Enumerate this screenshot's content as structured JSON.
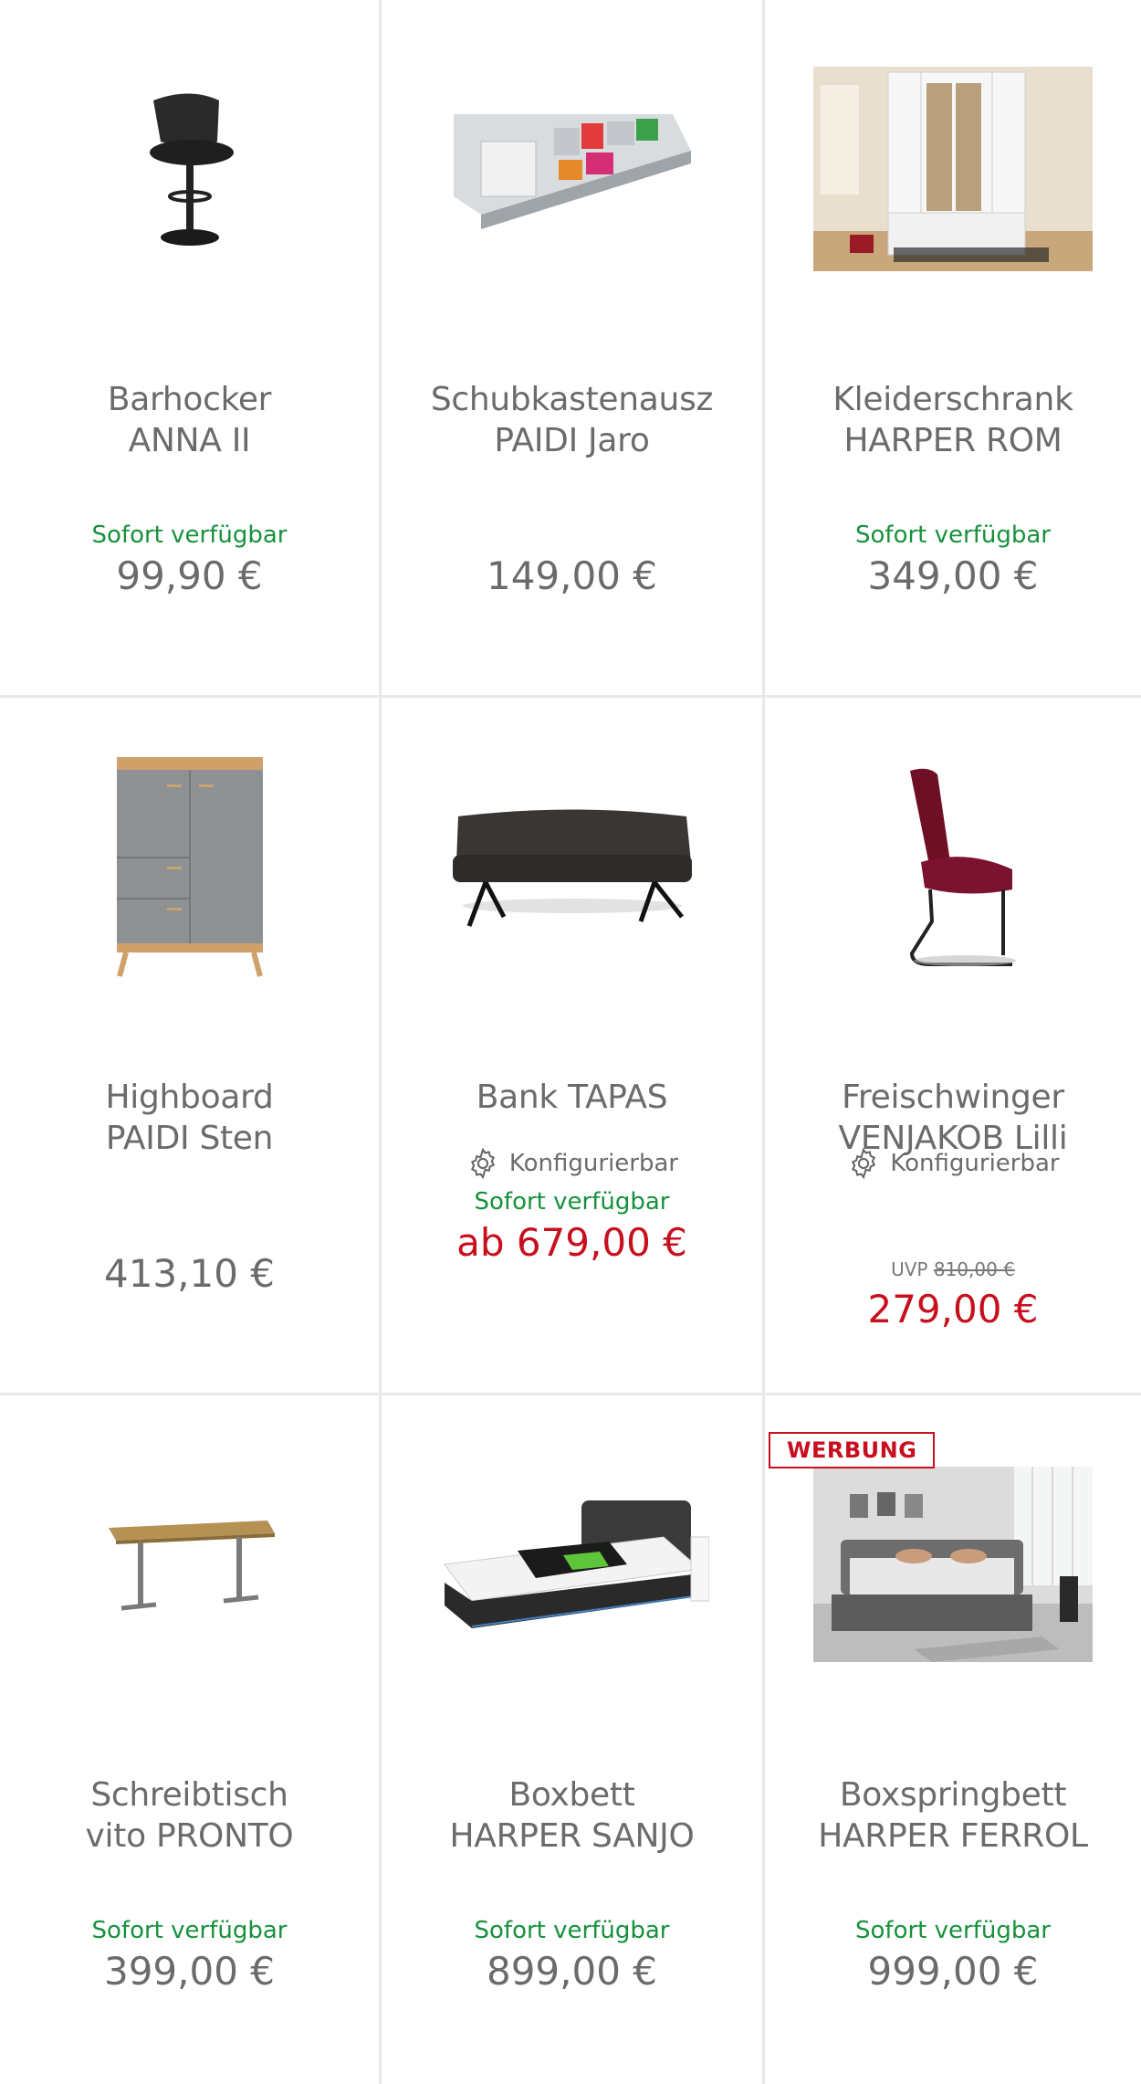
{
  "products": [
    {
      "title_line1": "Barhocker",
      "title_line2": "ANNA II",
      "availability": "Sofort verfügbar",
      "price": "99,90 €",
      "image": "bar-stool-image"
    },
    {
      "title_line1": "Schubkastenausz",
      "title_line2": "PAIDI Jaro",
      "availability": "",
      "price": "149,00 €",
      "image": "drawer-organizer-image"
    },
    {
      "title_line1": "Kleiderschrank",
      "title_line2": "HARPER ROM",
      "availability": "Sofort verfügbar",
      "price": "349,00 €",
      "image": "wardrobe-image"
    },
    {
      "title_line1": "Highboard",
      "title_line2": "PAIDI Sten",
      "availability": "",
      "price": "413,10 €",
      "image": "highboard-image"
    },
    {
      "title_line1": "Bank TAPAS",
      "title_line2": "",
      "configurable": "Konfigurierbar",
      "availability": "Sofort verfügbar",
      "price": "ab 679,00 €",
      "image": "bench-image"
    },
    {
      "title_line1": "Freischwinger",
      "title_line2": "VENJAKOB Lilli",
      "configurable": "Konfigurierbar",
      "uvp_label": "UVP",
      "uvp_price": "810,00 €",
      "price": "279,00 €",
      "image": "cantilever-chair-image"
    },
    {
      "title_line1": "Schreibtisch",
      "title_line2": "vito PRONTO",
      "availability": "Sofort verfügbar",
      "price": "399,00 €",
      "image": "desk-image"
    },
    {
      "title_line1": "Boxbett",
      "title_line2": "HARPER SANJO",
      "availability": "Sofort verfügbar",
      "price": "899,00 €",
      "image": "box-bed-image"
    },
    {
      "title_line1": "Boxspringbett",
      "title_line2": "HARPER FERROL",
      "availability": "Sofort verfügbar",
      "price": "999,00 €",
      "badge": "WERBUNG",
      "image": "boxspring-bed-room-image"
    }
  ],
  "colors": {
    "available": "#17913c",
    "sale": "#c80f1e",
    "text": "#6b6b6b",
    "divider": "#e6e8ea"
  }
}
